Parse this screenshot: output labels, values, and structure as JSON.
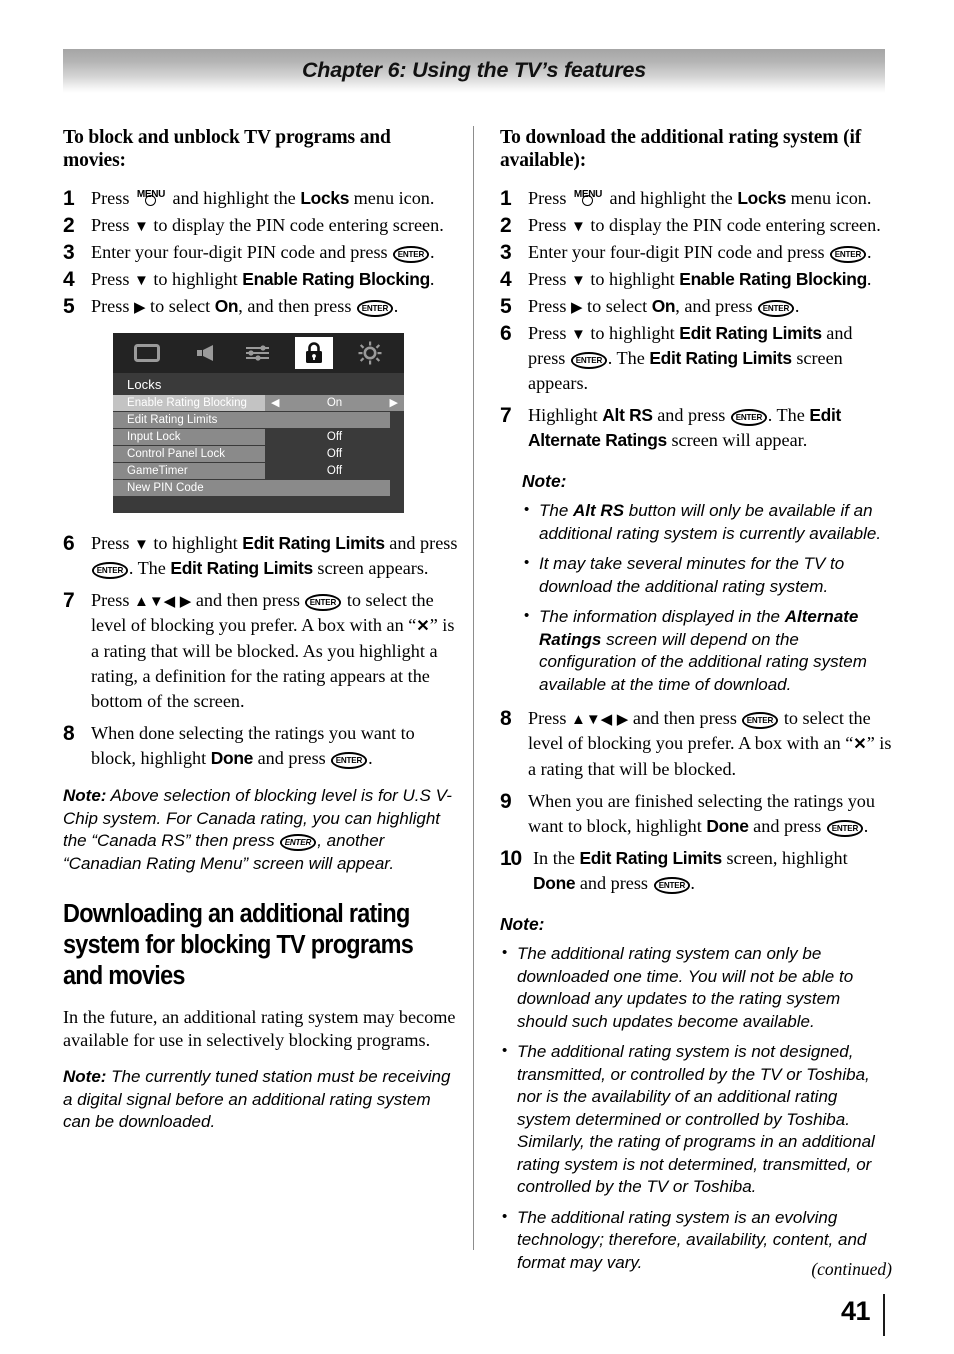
{
  "header": {
    "chapter_title": "Chapter 6: Using the TV’s features"
  },
  "left_column": {
    "heading": "To block and unblock TV programs and movies:",
    "steps": [
      {
        "num": "1",
        "text_before": "Press",
        "key": "MENU",
        "text_after": "and highlight the",
        "bold": "Locks",
        "text_end": "menu icon."
      },
      {
        "num": "2",
        "text": "Press ▼ to display the PIN code entering screen."
      },
      {
        "num": "3",
        "text": "Enter your four-digit PIN code and press ENTER."
      },
      {
        "num": "4",
        "text": "Press ▼ to highlight Enable Rating Blocking."
      },
      {
        "num": "5",
        "text": "Press ▶ to select On, and then press ENTER."
      },
      {
        "num": "6",
        "text": "Press ▼ to highlight Edit Rating Limits and press ENTER. The Edit Rating Limits screen appears."
      },
      {
        "num": "7",
        "text": "Press ▲▼◀ ▶ and then press ENTER to select the level of blocking you prefer. A box with an “✕” is a rating that will be blocked. As you highlight a rating, a definition for the rating appears at the bottom of the screen."
      },
      {
        "num": "8",
        "text": "When done selecting the ratings you want to block, highlight Done and press ENTER."
      }
    ],
    "step1_parts": {
      "press": "Press",
      "and_highlight": "and highlight the",
      "locks": "Locks",
      "menu_icon": "menu icon."
    },
    "step2_parts": {
      "press": "Press",
      "rest": "to display the PIN code entering screen."
    },
    "step3_parts": {
      "lead": "Enter your four-digit PIN code and press",
      "tail": "."
    },
    "step4_parts": {
      "press": "Press",
      "mid": "to highlight",
      "bold": "Enable Rating Blocking",
      "tail": "."
    },
    "step5_parts": {
      "press": "Press",
      "mid": "to select",
      "bold": "On",
      "mid2": ", and then press",
      "tail": "."
    },
    "step6_parts": {
      "press": "Press",
      "mid": "to highlight",
      "bold": "Edit Rating Limits",
      "mid2": "and press",
      "mid3": ". The",
      "bold2": "Edit Rating Limits",
      "tail": "screen appears."
    },
    "step7_parts": {
      "press": "Press",
      "mid": "and then press",
      "mid2": "to select the level of blocking you prefer. A box with an “",
      "mid3": "” is a rating that will be blocked. As you highlight a rating, a definition for the rating appears at the bottom of the screen."
    },
    "step8_parts": {
      "lead": "When done selecting the ratings you want to block, highlight",
      "bold": "Done",
      "mid": "and press",
      "tail": "."
    },
    "note1": {
      "lead": "Note:",
      "part1": " Above selection of blocking level is for U.S V-Chip system. For Canada rating, you can highlight the “Canada RS” then press",
      "part2": ", another “Canadian Rating Menu” screen will appear."
    },
    "section_heading": "Downloading an additional rating system for blocking TV programs and movies",
    "paragraph": "In the future, an additional rating system may become available for use in selectively blocking programs.",
    "note2": {
      "lead": "Note:",
      "text": " The currently tuned station must be receiving a digital signal before an additional rating system can be downloaded."
    }
  },
  "osd_menu": {
    "icons": [
      {
        "name": "picture-icon",
        "active": false
      },
      {
        "name": "audio-icon",
        "active": false
      },
      {
        "name": "preferences-icon",
        "active": false
      },
      {
        "name": "lock-icon",
        "active": true
      },
      {
        "name": "setup-icon",
        "active": false
      }
    ],
    "title": "Locks",
    "rows": [
      {
        "label": "Enable Rating Blocking",
        "value": "On",
        "selected": true,
        "arrows": true,
        "full": false
      },
      {
        "label": "Edit Rating Limits",
        "value": "",
        "selected": false,
        "arrows": false,
        "full": true
      },
      {
        "label": "Input Lock",
        "value": "Off",
        "selected": false,
        "arrows": false,
        "full": false
      },
      {
        "label": "Control Panel Lock",
        "value": "Off",
        "selected": false,
        "arrows": false,
        "full": false
      },
      {
        "label": "GameTimer",
        "value": "Off",
        "selected": false,
        "arrows": false,
        "full": false
      },
      {
        "label": "New PIN Code",
        "value": "",
        "selected": false,
        "arrows": false,
        "full": true
      }
    ],
    "left_arrow": "◀",
    "right_arrow": "▶"
  },
  "right_column": {
    "heading": "To download the additional rating system (if available):",
    "step1_parts": {
      "press": "Press",
      "and_highlight": "and highlight the",
      "locks": "Locks",
      "menu_icon": "menu icon."
    },
    "step2_parts": {
      "press": "Press",
      "rest": "to display the PIN code entering screen."
    },
    "step3_parts": {
      "lead": "Enter your four-digit PIN code and press",
      "tail": "."
    },
    "step4_parts": {
      "press": "Press",
      "mid": "to highlight",
      "bold": "Enable Rating Blocking",
      "tail": "."
    },
    "step5_parts": {
      "press": "Press",
      "mid": "to select",
      "bold": "On",
      "mid2": ", and press",
      "tail": "."
    },
    "step6_parts": {
      "press": "Press",
      "mid": "to highlight",
      "bold": "Edit Rating Limits",
      "mid2": "and press",
      "mid3": ". The",
      "bold2": "Edit Rating Limits",
      "tail": "screen appears."
    },
    "step7_parts": {
      "lead": "Highlight",
      "bold": "Alt RS",
      "mid": "and press",
      "mid2": ". The",
      "bold2": "Edit Alternate Ratings",
      "tail": "screen will appear."
    },
    "note_head_1": "Note:",
    "note_bullets_1": [
      {
        "pre": "The ",
        "bold": "Alt RS",
        "post": " button will only be available if an additional rating system is currently available."
      },
      {
        "pre": "It may take several minutes for the TV to download the additional rating system.",
        "bold": "",
        "post": ""
      },
      {
        "pre": "The information displayed in the ",
        "bold": "Alternate Ratings",
        "post": " screen will depend on the configuration of the additional rating system available at the time of download."
      }
    ],
    "step8_parts": {
      "press": "Press",
      "mid": "and then press",
      "mid2": "to select the level of blocking you prefer. A box with an “",
      "mid3": "” is a rating that will be blocked."
    },
    "step9_parts": {
      "lead": "When you are finished selecting the ratings you want to block, highlight",
      "bold": "Done",
      "mid": "and press",
      "tail": "."
    },
    "step10_parts": {
      "lead": "In the",
      "bold": "Edit Rating Limits",
      "mid": "screen, highlight",
      "bold2": "Done",
      "mid2": "and press",
      "tail": "."
    },
    "note_head_2": "Note:",
    "note_bullets_2": [
      {
        "text": "The additional rating system can only be downloaded one time. You will not be able to download any updates to the rating system should such updates become available."
      },
      {
        "text": "The additional rating system is not designed, transmitted, or controlled by the TV or Toshiba, nor is the availability of an additional rating system determined or controlled by Toshiba. Similarly, the rating of programs in an additional rating system is not determined, transmitted, or controlled by the TV or Toshiba."
      },
      {
        "text": "The additional rating system is an evolving technology; therefore, availability, content, and format may vary."
      }
    ]
  },
  "footer": {
    "continued": "(continued)",
    "page_number": "41"
  },
  "glyphs": {
    "enter": "ENTER",
    "menu": "MENU",
    "down": "▼",
    "right": "▶",
    "left": "◀",
    "up": "▲",
    "xmark": "✕"
  },
  "step_numbers": {
    "n1": "1",
    "n2": "2",
    "n3": "3",
    "n4": "4",
    "n5": "5",
    "n6": "6",
    "n7": "7",
    "n8": "8",
    "n9": "9",
    "n10": "10"
  }
}
